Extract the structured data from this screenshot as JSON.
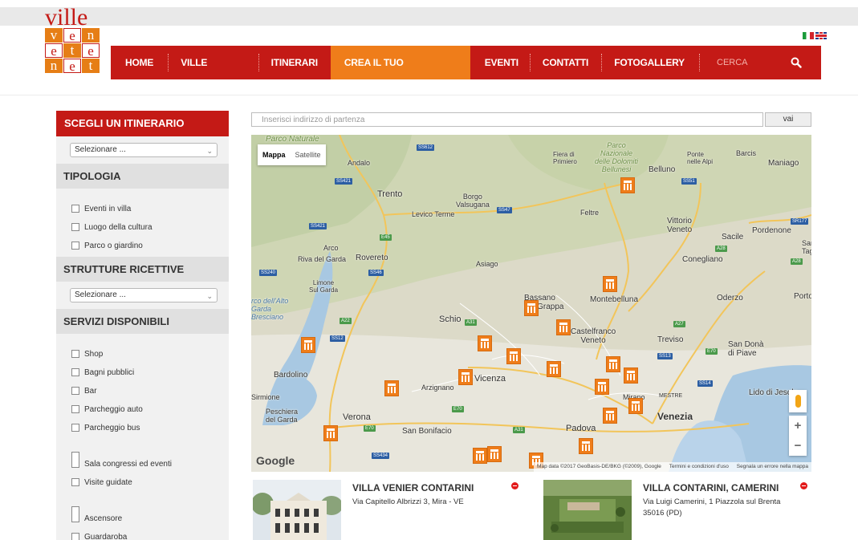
{
  "logo": {
    "word": "ville",
    "letters": [
      "v",
      "e",
      "n",
      "e",
      "t",
      "e",
      "n",
      "e",
      "t"
    ]
  },
  "languages": [
    "it",
    "en"
  ],
  "nav": {
    "items": [
      "HOME",
      "VILLE VENETE",
      "ITINERARI",
      "CREA IL TUO ITINERARIO",
      "EVENTI",
      "CONTATTI",
      "FOTOGALLERY"
    ],
    "active": "CREA IL TUO ITINERARIO",
    "search_placeholder": "CERCA"
  },
  "sidebar": {
    "itinerary_title": "SCEGLI UN ITINERARIO",
    "itinerary_select": "Selezionare ...",
    "tipologia_title": "TIPOLOGIA",
    "tipologia_items": [
      "Eventi in villa",
      "Luogo della cultura",
      "Parco o giardino"
    ],
    "strutture_title": "STRUTTURE RICETTIVE",
    "strutture_select": "Selezionare ...",
    "servizi_title": "SERVIZI DISPONIBILI",
    "servizi_items": [
      "Shop",
      "Bagni pubblici",
      "Bar",
      "Parcheggio auto",
      "Parcheggio bus",
      "Sala congressi ed eventi",
      "Visite guidate",
      "Ascensore",
      "Guardaroba"
    ]
  },
  "map": {
    "address_placeholder": "Inserisci indirizzo di partenza",
    "go_label": "vai",
    "type_map": "Mappa",
    "type_satellite": "Satellite",
    "google": "Google",
    "attribution": "Map data ©2017 GeoBasis-DE/BKG (©2009), Google",
    "terms": "Termini e condizioni d'uso",
    "report": "Segnala un errore nella mappa",
    "zoom_in": "+",
    "zoom_out": "−",
    "labels": {
      "parco_naturale": "Parco Naturale",
      "andalo": "Andalo",
      "fiera": "Fiera di\nPrimiero",
      "dolomiti": "Parco\nNazionale\ndelle Dolomiti\nBellunesi",
      "ponte": "Ponte\nnelle Alpi",
      "barcis": "Barcis",
      "maniago": "Maniago",
      "belluno": "Belluno",
      "trento": "Trento",
      "borgo": "Borgo\nValsugana",
      "levico": "Levico Terme",
      "feltre": "Feltre",
      "vittorio": "Vittorio\nVeneto",
      "sacile": "Sacile",
      "pordenone": "Pordenone",
      "sag": "Sar\nTag",
      "arco": "Arco",
      "riva": "Riva del Garda",
      "rovereto": "Rovereto",
      "asiago": "Asiago",
      "conegliano": "Conegliano",
      "limone": "Limone\nSul Garda",
      "parco_alto_garda": "rco dell'Alto\nGarda\nBresciano",
      "bassano": "Bassano\ndel Grappa",
      "montebelluna": "Montebelluna",
      "oderzo": "Oderzo",
      "porto": "Porto",
      "schio": "Schio",
      "castelfranco": "Castelfranco\nVeneto",
      "treviso": "Treviso",
      "sandona": "San Donà\ndi Piave",
      "bardolino": "Bardolino",
      "vicenza": "Vicenza",
      "arzignano": "Arzignano",
      "sirmione": "Sirmione",
      "lido": "Lido di Jesolo",
      "mestre": "MESTRE",
      "mirano": "Mirano",
      "peschiera": "Peschiera\ndel Garda",
      "verona": "Verona",
      "venezia": "Venezia",
      "padova": "Padova",
      "sanbonifacio": "San Bonifacio"
    }
  },
  "results": [
    {
      "title": "VILLA VENIER CONTARINI",
      "address": "Via Capitello Albrizzi 3, Mira - VE"
    },
    {
      "title": "VILLA CONTARINI, CAMERINI",
      "address": "Via Luigi Camerini, 1 Piazzola sul Brenta 35016 (PD)"
    }
  ],
  "colors": {
    "brand_red": "#c41a16",
    "brand_orange": "#ef7d1a"
  }
}
